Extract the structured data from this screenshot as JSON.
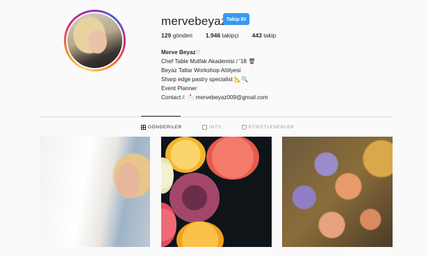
{
  "profile": {
    "username": "mervebeyaz",
    "follow_label": "Takip Et",
    "stats": [
      {
        "count": "129",
        "label": "gönderi"
      },
      {
        "count": "1.946",
        "label": "takipçi"
      },
      {
        "count": "443",
        "label": "takip"
      }
    ],
    "bio": {
      "name": "Merve Beyaz",
      "name_glyph": "♡",
      "lines": [
        "Chef Table Mutfak Akademisi / '18 🗑",
        "Beyaz Tatlar Workshop Atölyesi",
        "Sharp edge pastry specialist 📐🔍",
        "Event Planner",
        "Contact /: 📩 mervebeyaz009@gmail.com"
      ]
    }
  },
  "tabs": [
    {
      "label": "GÖNDERILER",
      "icon": "grid-icon",
      "active": true
    },
    {
      "label": "IGTV",
      "icon": "tv-icon",
      "active": false
    },
    {
      "label": "ETİKETLENENLER",
      "icon": "tag-icon",
      "active": false
    }
  ],
  "posts": [
    {
      "subject": "selfie"
    },
    {
      "subject": "citrus slices"
    },
    {
      "subject": "flowers and gold dishes"
    }
  ]
}
